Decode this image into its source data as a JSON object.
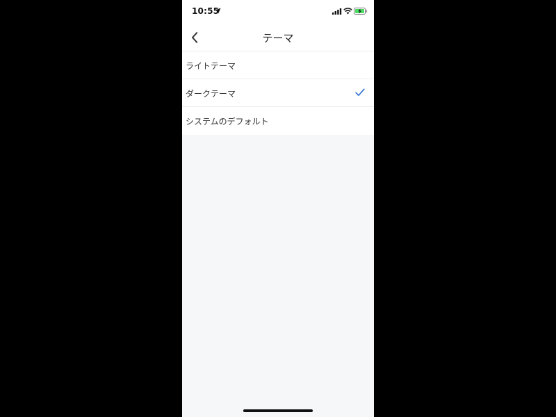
{
  "status_bar": {
    "time": "10:55",
    "icons": [
      "location-arrow-icon",
      "cellular-signal-icon",
      "wifi-icon",
      "battery-charging-icon"
    ]
  },
  "nav": {
    "back_icon": "chevron-left-icon",
    "title": "テーマ"
  },
  "theme_options": [
    {
      "label": "ライトテーマ",
      "selected": false
    },
    {
      "label": "ダークテーマ",
      "selected": true
    },
    {
      "label": "システムのデフォルト",
      "selected": false
    }
  ],
  "colors": {
    "checkmark": "#3f7bd4",
    "background": "#f6f7f9",
    "battery_charge": "#4cd964"
  }
}
